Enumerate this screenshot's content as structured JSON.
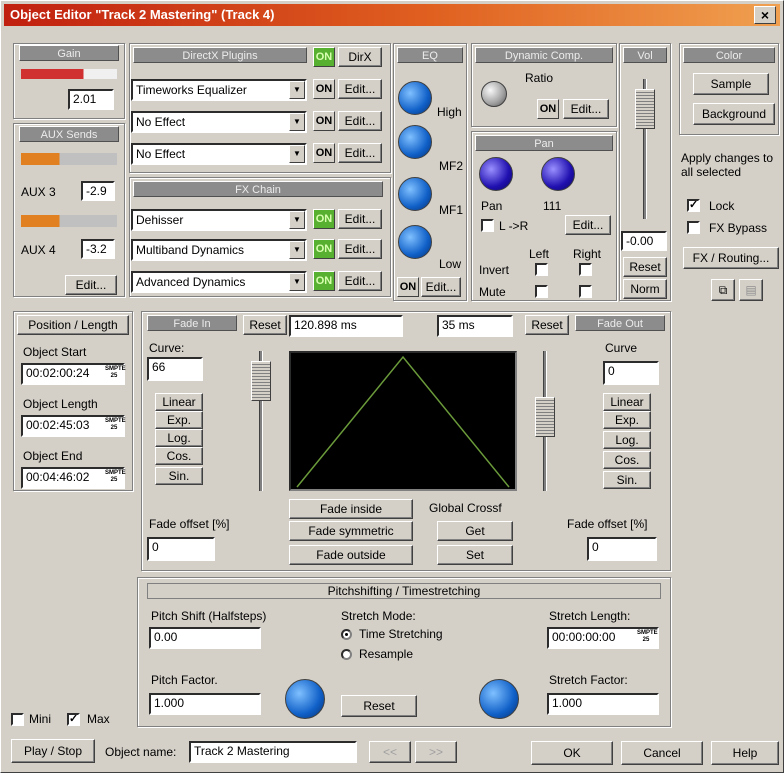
{
  "window": {
    "title": "Object Editor \"Track 2 Mastering\" (Track 4)",
    "close_icon": "close-icon"
  },
  "gain": {
    "header": "Gain",
    "value": "2.01"
  },
  "aux": {
    "header": "AUX Sends",
    "aux3_label": "AUX 3",
    "aux3_value": "-2.9",
    "aux4_label": "AUX 4",
    "aux4_value": "-3.2",
    "edit": "Edit..."
  },
  "directx": {
    "header": "DirectX Plugins",
    "on": "ON",
    "dx": "DirX",
    "slots": [
      {
        "name": "Timeworks Equalizer",
        "on": "ON",
        "edit": "Edit..."
      },
      {
        "name": "No Effect",
        "on": "ON",
        "edit": "Edit..."
      },
      {
        "name": "No Effect",
        "on": "ON",
        "edit": "Edit..."
      }
    ]
  },
  "fxchain": {
    "header": "FX Chain",
    "slots": [
      {
        "name": "Dehisser",
        "on": "ON",
        "edit": "Edit..."
      },
      {
        "name": "Multiband Dynamics",
        "on": "ON",
        "edit": "Edit..."
      },
      {
        "name": "Advanced Dynamics",
        "on": "ON",
        "edit": "Edit..."
      }
    ]
  },
  "eq": {
    "header": "EQ",
    "bands": [
      "High",
      "MF2",
      "MF1",
      "Low"
    ],
    "on": "ON",
    "edit": "Edit..."
  },
  "dynamic": {
    "header": "Dynamic Comp.",
    "ratio": "Ratio",
    "on": "ON",
    "edit": "Edit..."
  },
  "pan": {
    "header": "Pan",
    "label": "Pan",
    "value": "111",
    "lr": "L ->R",
    "edit": "Edit...",
    "left": "Left",
    "right": "Right",
    "invert": "Invert",
    "mute": "Mute"
  },
  "vol": {
    "header": "Vol",
    "value": "-0.00",
    "reset": "Reset",
    "norm": "Norm"
  },
  "color": {
    "header": "Color",
    "sample": "Sample",
    "background": "Background",
    "apply": "Apply changes to all selected",
    "lock": "Lock",
    "fx_bypass": "FX Bypass",
    "fx_routing": "FX / Routing..."
  },
  "position": {
    "header": "Position / Length",
    "start_label": "Object Start",
    "start_value": "00:02:00:24",
    "length_label": "Object Length",
    "length_value": "00:02:45:03",
    "end_label": "Object End",
    "end_value": "00:04:46:02",
    "smpte": "SMPTE",
    "fps": "25"
  },
  "fadein": {
    "header": "Fade In",
    "reset": "Reset",
    "time": "120.898 ms",
    "curve_label": "Curve:",
    "curve_value": "66",
    "shapes": [
      "Linear",
      "Exp.",
      "Log.",
      "Cos.",
      "Sin."
    ],
    "offset_label": "Fade offset [%]",
    "offset_value": "0"
  },
  "fadeout": {
    "header": "Fade Out",
    "reset": "Reset",
    "time": "35 ms",
    "curve_label": "Curve",
    "curve_value": "0",
    "shapes": [
      "Linear",
      "Exp.",
      "Log.",
      "Cos.",
      "Sin."
    ],
    "offset_label": "Fade offset [%]",
    "offset_value": "0"
  },
  "crossfade": {
    "fade_inside": "Fade inside",
    "fade_symmetric": "Fade symmetric",
    "fade_outside": "Fade outside",
    "global": "Global Crossf",
    "get": "Get",
    "set": "Set"
  },
  "pitch": {
    "header": "Pitchshifting / Timestretching",
    "shift_label": "Pitch Shift (Halfsteps)",
    "shift_value": "0.00",
    "mode_label": "Stretch Mode:",
    "mode_time": "Time Stretching",
    "mode_resample": "Resample",
    "length_label": "Stretch Length:",
    "length_value": "00:00:00:00",
    "factor_label": "Pitch Factor.",
    "factor_value": "1.000",
    "reset": "Reset",
    "stretch_factor_label": "Stretch Factor:",
    "stretch_factor_value": "1.000"
  },
  "footer": {
    "mini": "Mini",
    "max": "Max",
    "play_stop": "Play / Stop",
    "object_name_label": "Object name:",
    "object_name_value": "Track 2 Mastering",
    "prev": "<<",
    "next": ">>",
    "ok": "OK",
    "cancel": "Cancel",
    "help": "Help"
  }
}
